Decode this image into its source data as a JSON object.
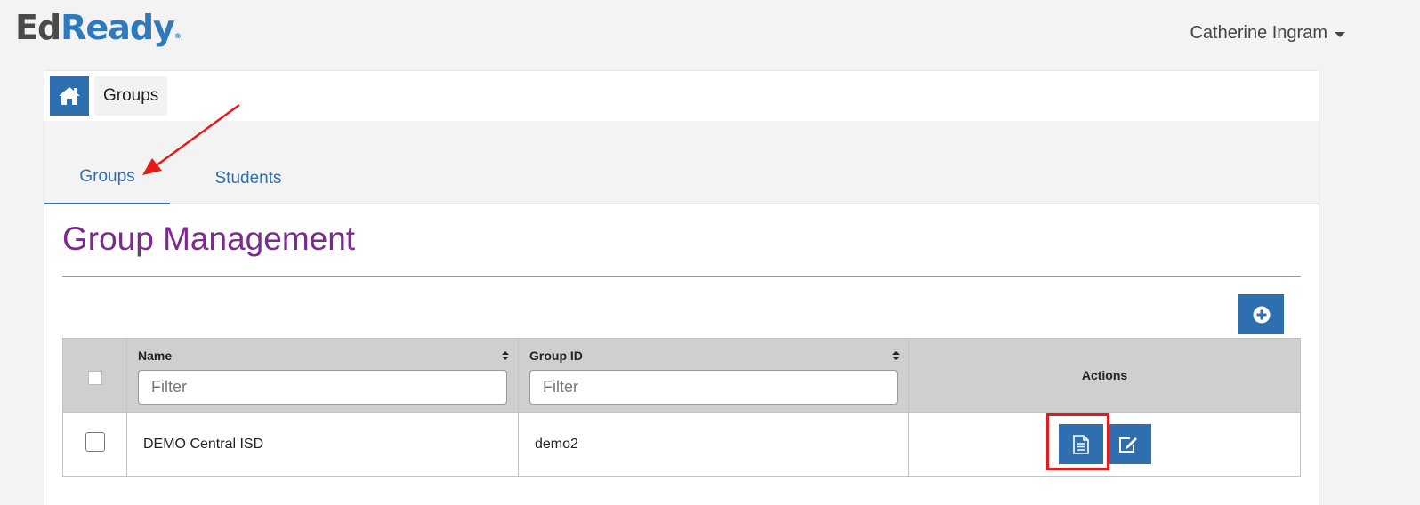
{
  "brand": {
    "part1": "Ed",
    "part2": "Ready",
    "mark": "®"
  },
  "user": {
    "name": "Catherine Ingram"
  },
  "breadcrumb": {
    "home_icon": "home-icon",
    "current": "Groups"
  },
  "tabs": [
    {
      "label": "Groups",
      "active": true
    },
    {
      "label": "Students",
      "active": false
    }
  ],
  "page": {
    "title": "Group Management",
    "add_icon": "plus-circle-icon"
  },
  "table": {
    "columns": {
      "name": "Name",
      "group_id": "Group ID",
      "actions": "Actions"
    },
    "filters": {
      "name_placeholder": "Filter",
      "group_id_placeholder": "Filter"
    },
    "rows": [
      {
        "name": "DEMO Central ISD",
        "group_id": "demo2"
      }
    ],
    "row_actions": [
      "report-icon",
      "edit-icon"
    ]
  },
  "colors": {
    "accent": "#2f6fb0",
    "title": "#7c2a8c",
    "annotation": "#e41b1b"
  }
}
